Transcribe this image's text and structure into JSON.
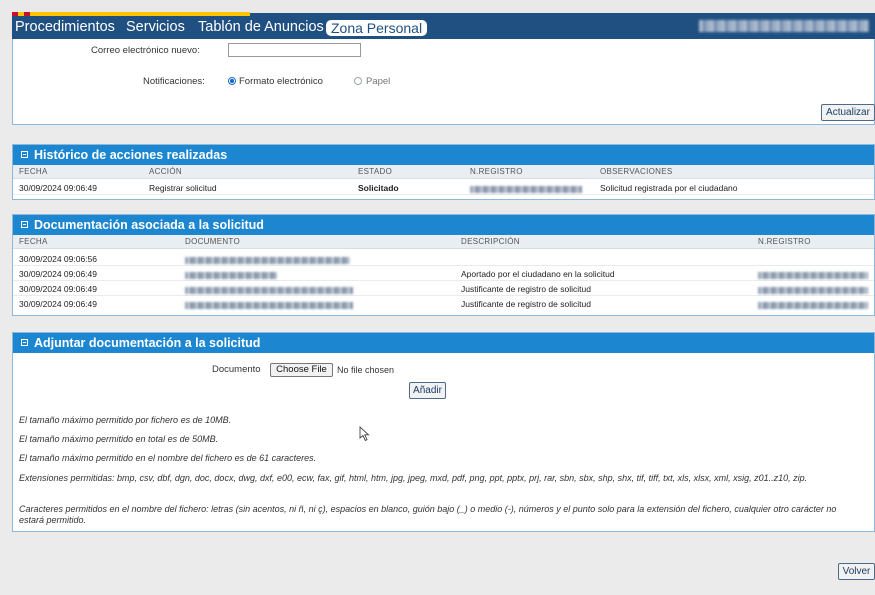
{
  "nav": {
    "items": [
      "Procedimientos",
      "Servicios",
      "Tablón de Anuncios"
    ],
    "active": "Zona Personal",
    "user_name_blurred": true
  },
  "contact": {
    "email_label": "Correo electrónico nuevo:",
    "email_value": "",
    "notif_label": "Notificaciones:",
    "option_electronic": "Formato electrónico",
    "option_paper": "Papel",
    "update_button": "Actualizar"
  },
  "history": {
    "title": "Histórico de acciones realizadas",
    "columns": [
      "FECHA",
      "ACCIÓN",
      "ESTADO",
      "N.REGISTRO",
      "OBSERVACIONES"
    ],
    "rows": [
      {
        "fecha": "30/09/2024 09:06:49",
        "accion": "Registrar solicitud",
        "estado": "Solicitado",
        "observaciones": "Solicitud registrada por el ciudadano"
      }
    ]
  },
  "documents": {
    "title": "Documentación asociada a la solicitud",
    "columns": [
      "FECHA",
      "DOCUMENTO",
      "DESCRIPCIÓN",
      "N.REGISTRO"
    ],
    "rows": [
      {
        "fecha": "30/09/2024 09:06:56",
        "descripcion": ""
      },
      {
        "fecha": "30/09/2024 09:06:49",
        "descripcion": "Aportado por el ciudadano en la solicitud"
      },
      {
        "fecha": "30/09/2024 09:06:49",
        "descripcion": "Justificante de registro de solicitud"
      },
      {
        "fecha": "30/09/2024 09:06:49",
        "descripcion": "Justificante de registro de solicitud"
      }
    ]
  },
  "attach": {
    "title": "Adjuntar documentación a la solicitud",
    "doc_label": "Documento",
    "choose_button": "Choose File",
    "no_file": "No file chosen",
    "add_button": "Añadir",
    "notes": [
      "El tamaño máximo permitido por fichero es de 10MB.",
      "El tamaño máximo permitido en total es de 50MB.",
      "El tamaño máximo permitido en el nombre del fichero es de 61 caracteres.",
      "Extensiones permitidas: bmp, csv, dbf, dgn, doc, docx, dwg, dxf, e00, ecw, fax, gif, html, htm, jpg, jpeg, mxd, pdf, png, ppt, pptx, prj, rar, sbn, sbx, shp, shx, tif, tiff, txt, xls, xlsx, xml, xsig, z01..z10, zip.",
      "Caracteres permitidos en el nombre del fichero: letras (sin acentos, ni ñ, ni ç), espacios en blanco, guión bajo (_) o medio (-), números y el punto solo para la extensión del fichero, cualquier otro carácter no estará permitido."
    ]
  },
  "footer": {
    "back_button": "Volver"
  },
  "colors": {
    "nav_bg": "#1f5081",
    "panel_header": "#1d86d0",
    "page_bg": "#ebebeb"
  }
}
